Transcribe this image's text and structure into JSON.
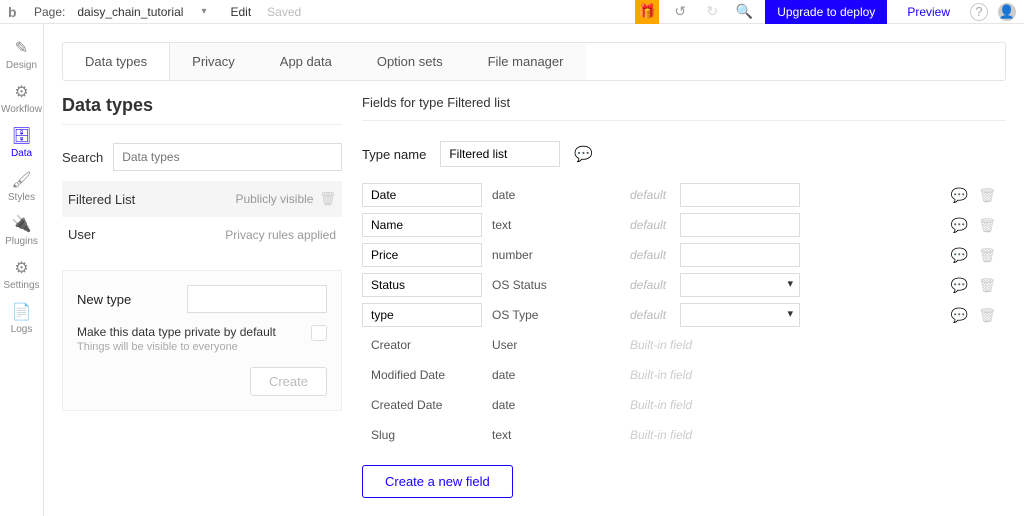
{
  "topbar": {
    "page_prefix": "Page:",
    "page_name": "daisy_chain_tutorial",
    "edit": "Edit",
    "saved": "Saved",
    "upgrade": "Upgrade to deploy",
    "preview": "Preview"
  },
  "rail": {
    "items": [
      {
        "id": "design",
        "label": "Design",
        "icon": "✎"
      },
      {
        "id": "workflow",
        "label": "Workflow",
        "icon": "⚙"
      },
      {
        "id": "data",
        "label": "Data",
        "icon": "🗄"
      },
      {
        "id": "styles",
        "label": "Styles",
        "icon": "🖌"
      },
      {
        "id": "plugins",
        "label": "Plugins",
        "icon": "🔌"
      },
      {
        "id": "settings",
        "label": "Settings",
        "icon": "⚙"
      },
      {
        "id": "logs",
        "label": "Logs",
        "icon": "📄"
      }
    ],
    "active": "data"
  },
  "tabs": {
    "items": [
      "Data types",
      "Privacy",
      "App data",
      "Option sets",
      "File manager"
    ],
    "active": 0
  },
  "left": {
    "title": "Data types",
    "search_label": "Search",
    "search_placeholder": "Data types",
    "types": [
      {
        "name": "Filtered List",
        "meta": "Publicly visible",
        "selected": true,
        "deletable": true
      },
      {
        "name": "User",
        "meta": "Privacy rules applied",
        "selected": false,
        "deletable": false
      }
    ],
    "newtype_label": "New type",
    "private_label": "Make this data type private by default",
    "private_sub": "Things will be visible to everyone",
    "create_btn": "Create"
  },
  "right": {
    "title": "Fields for type Filtered list",
    "typename_label": "Type name",
    "typename_value": "Filtered list",
    "fields": [
      {
        "name": "Date",
        "type": "date",
        "kind": "input"
      },
      {
        "name": "Name",
        "type": "text",
        "kind": "input"
      },
      {
        "name": "Price",
        "type": "number",
        "kind": "input"
      },
      {
        "name": "Status",
        "type": "OS Status",
        "kind": "select"
      },
      {
        "name": "type",
        "type": "OS Type",
        "kind": "select"
      }
    ],
    "default_label": "default",
    "builtin_fields": [
      {
        "name": "Creator",
        "type": "User"
      },
      {
        "name": "Modified Date",
        "type": "date"
      },
      {
        "name": "Created Date",
        "type": "date"
      },
      {
        "name": "Slug",
        "type": "text"
      }
    ],
    "builtin_label": "Built-in field",
    "create_field_btn": "Create a new field"
  }
}
